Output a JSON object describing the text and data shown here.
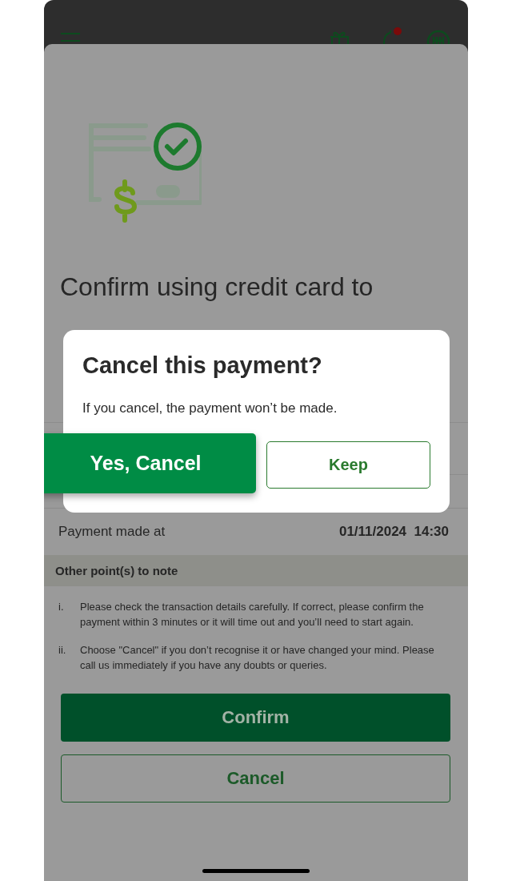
{
  "heading": "Confirm using credit card to",
  "details": [
    {
      "label": "Payment made at",
      "value": "01/11/2024  14:30"
    }
  ],
  "notes": {
    "title": "Other point(s) to note",
    "items": [
      {
        "marker": "i.",
        "text": "Please check the transaction details carefully. If correct, please confirm the payment within 3 minutes or it will time out and you’ll need to start again."
      },
      {
        "marker": "ii.",
        "text": "Choose \"Cancel\" if you don’t recognise it or have changed your mind. Please call us immediately if you have any doubts or queries."
      }
    ]
  },
  "buttons": [
    {
      "label": "Confirm",
      "kind": "primary"
    },
    {
      "label": "Cancel",
      "kind": "outline"
    }
  ],
  "dialog": {
    "title": "Cancel this payment?",
    "message": "If you cancel, the payment won’t be made.",
    "buttons": [
      {
        "label": "Yes, Cancel",
        "kind": "primary"
      },
      {
        "label": "Keep",
        "kind": "outline"
      }
    ]
  }
}
